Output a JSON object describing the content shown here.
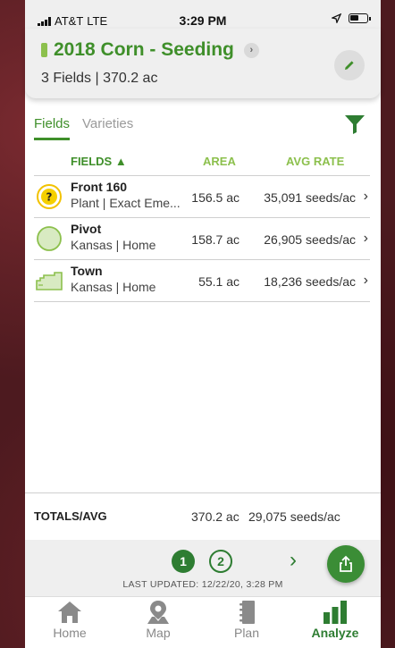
{
  "status_bar": {
    "carrier": "AT&T",
    "network": "LTE",
    "time": "3:29 PM"
  },
  "header": {
    "title": "2018 Corn - Seeding",
    "subtitle": "3 Fields | 370.2 ac",
    "edit_icon": "pencil-icon",
    "accent_color": "#3f8f2a"
  },
  "tabs": [
    {
      "label": "Fields",
      "active": true
    },
    {
      "label": "Varieties",
      "active": false
    }
  ],
  "table": {
    "columns": {
      "fields": "FIELDS ▲",
      "area": "AREA",
      "rate": "AVG RATE"
    },
    "rows": [
      {
        "name": "Front 160",
        "sub": "Plant | Exact Eme...",
        "area": "156.5 ac",
        "rate": "35,091 seeds/ac",
        "icon": "unknown-boundary-icon"
      },
      {
        "name": "Pivot",
        "sub": "Kansas | Home",
        "area": "158.7 ac",
        "rate": "26,905 seeds/ac",
        "icon": "circle-field-icon"
      },
      {
        "name": "Town",
        "sub": "Kansas | Home",
        "area": "55.1 ac",
        "rate": "18,236 seeds/ac",
        "icon": "field-shape-icon"
      }
    ]
  },
  "totals": {
    "label": "TOTALS/AVG",
    "area": "370.2 ac",
    "rate": "29,075 seeds/ac"
  },
  "pager": {
    "pages": [
      "1",
      "2"
    ],
    "active_page": "1",
    "last_updated": "LAST UPDATED: 12/22/20, 3:28 PM"
  },
  "bottom_nav": [
    {
      "label": "Home",
      "icon": "home-icon",
      "active": false
    },
    {
      "label": "Map",
      "icon": "map-pin-icon",
      "active": false
    },
    {
      "label": "Plan",
      "icon": "notebook-icon",
      "active": false
    },
    {
      "label": "Analyze",
      "icon": "bar-chart-icon",
      "active": true
    }
  ]
}
